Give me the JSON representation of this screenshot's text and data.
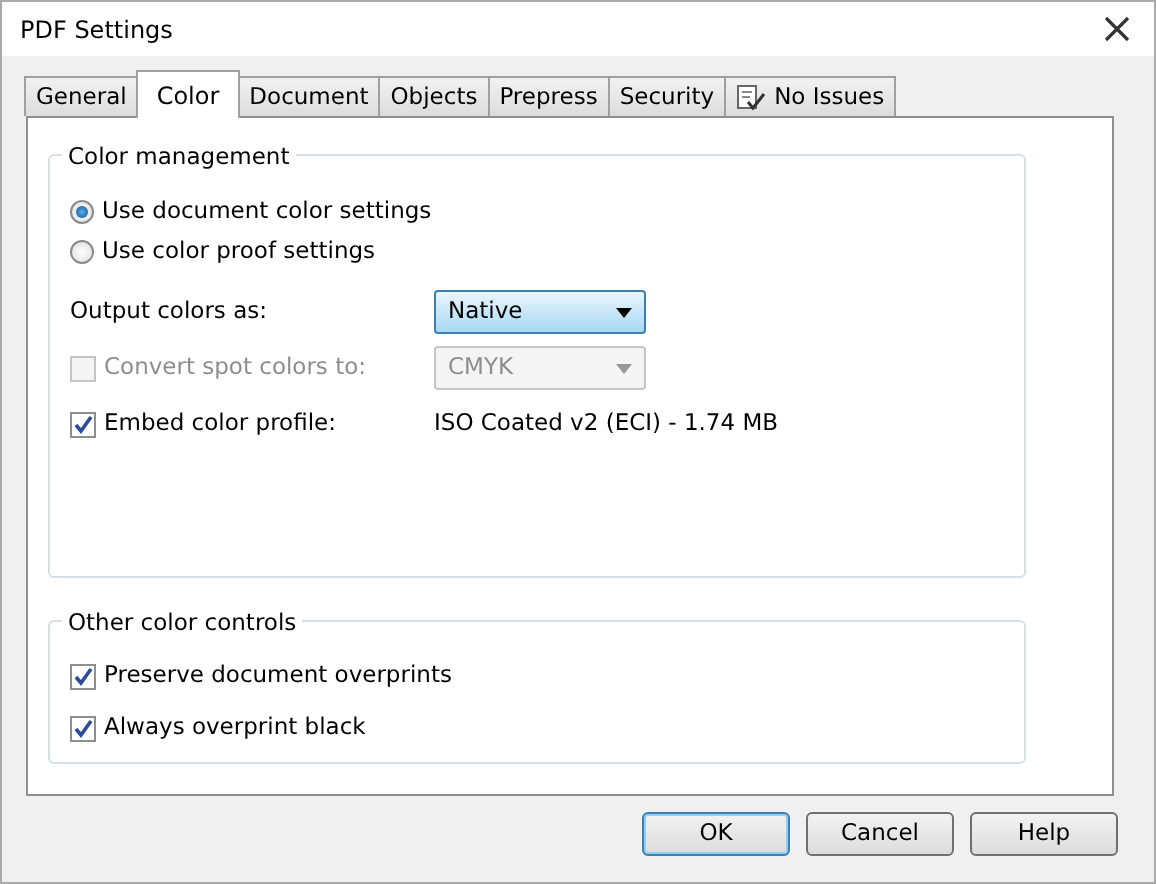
{
  "window": {
    "title": "PDF Settings"
  },
  "tabs": [
    {
      "label": "General",
      "selected": false,
      "kind": "plain"
    },
    {
      "label": "Color",
      "selected": true,
      "kind": "plain"
    },
    {
      "label": "Document",
      "selected": false,
      "kind": "plain"
    },
    {
      "label": "Objects",
      "selected": false,
      "kind": "plain"
    },
    {
      "label": "Prepress",
      "selected": false,
      "kind": "plain"
    },
    {
      "label": "Security",
      "selected": false,
      "kind": "plain"
    },
    {
      "label": "No Issues",
      "selected": false,
      "kind": "issues"
    }
  ],
  "color_management": {
    "legend": "Color management",
    "radios": [
      {
        "label": "Use document color settings",
        "selected": true
      },
      {
        "label": "Use color proof settings",
        "selected": false
      }
    ],
    "rows": [
      {
        "kind": "select",
        "label": "Output colors as:",
        "value": "Native",
        "disabled": false,
        "focused": true
      },
      {
        "kind": "checkbox-select",
        "label": "Convert spot colors to:",
        "checked": false,
        "value": "CMYK",
        "disabled": true
      },
      {
        "kind": "checkbox-text",
        "label": "Embed color profile:",
        "checked": true,
        "value": "ISO Coated v2 (ECI) - 1.74 MB",
        "disabled": false
      }
    ]
  },
  "other_color_controls": {
    "legend": "Other color controls",
    "checkboxes": [
      {
        "label": "Preserve document overprints",
        "checked": true
      },
      {
        "label": "Always overprint black",
        "checked": true
      }
    ]
  },
  "buttons": [
    {
      "label": "OK",
      "default": true
    },
    {
      "label": "Cancel",
      "default": false
    },
    {
      "label": "Help",
      "default": false
    }
  ]
}
